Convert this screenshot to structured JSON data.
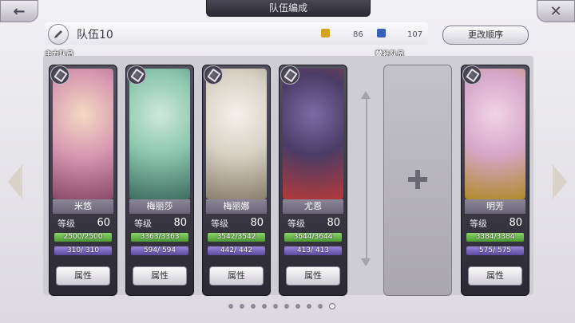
{
  "header": {
    "title": "队伍编成"
  },
  "team": {
    "name": "队伍10",
    "order_button": "更改顺序"
  },
  "resources": [
    {
      "icon": "天",
      "value": "86",
      "color": "#d4a21e"
    },
    {
      "icon": "星",
      "value": "107",
      "color": "#3a5fb8"
    }
  ],
  "sections": {
    "main": "主力队员",
    "reserve": "替补队员"
  },
  "common": {
    "level_label": "等级",
    "attribute_button": "属性"
  },
  "members": [
    {
      "name": "米悠",
      "level": "60",
      "hp": "2500/2500",
      "mp": "310/ 310",
      "colors": [
        "#f3d9c2",
        "#d89ab2",
        "#8a4a6a"
      ]
    },
    {
      "name": "梅丽莎",
      "level": "80",
      "hp": "3363/3363",
      "mp": "594/ 594",
      "colors": [
        "#cfe8dc",
        "#8cc7b0",
        "#3e6d60"
      ]
    },
    {
      "name": "梅丽娜",
      "level": "80",
      "hp": "3542/3542",
      "mp": "442/ 442",
      "colors": [
        "#f4f1ea",
        "#d8d1c4",
        "#8b7f6c"
      ]
    },
    {
      "name": "尤恩",
      "level": "80",
      "hp": "3644/3644",
      "mp": "413/ 413",
      "colors": [
        "#7d6aa6",
        "#4a3c66",
        "#b43a3a"
      ]
    }
  ],
  "reserve": [
    {
      "name": "明芳",
      "level": "80",
      "hp": "3384/3384",
      "mp": "575/ 575",
      "colors": [
        "#f0d4e6",
        "#d6a6c9",
        "#b08a2a"
      ]
    }
  ],
  "pagination": {
    "count": 10,
    "active": 9
  }
}
